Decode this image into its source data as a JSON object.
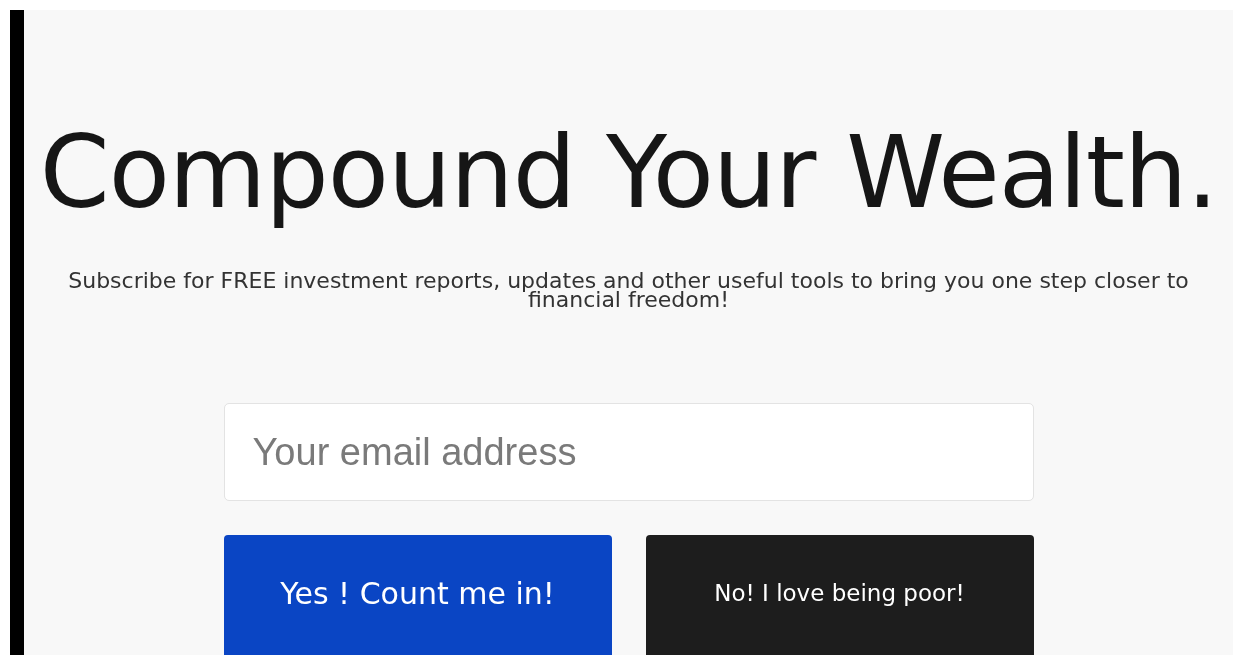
{
  "heading": "Compound Your Wealth.",
  "subheading": "Subscribe for FREE investment reports, updates and other useful tools to bring you one step closer to financial freedom!",
  "email_field": {
    "placeholder": "Your email address"
  },
  "buttons": [
    {
      "label": "Yes ! Count me in!",
      "kind": "accept"
    },
    {
      "label": "No! I love being poor!",
      "kind": "decline"
    }
  ]
}
